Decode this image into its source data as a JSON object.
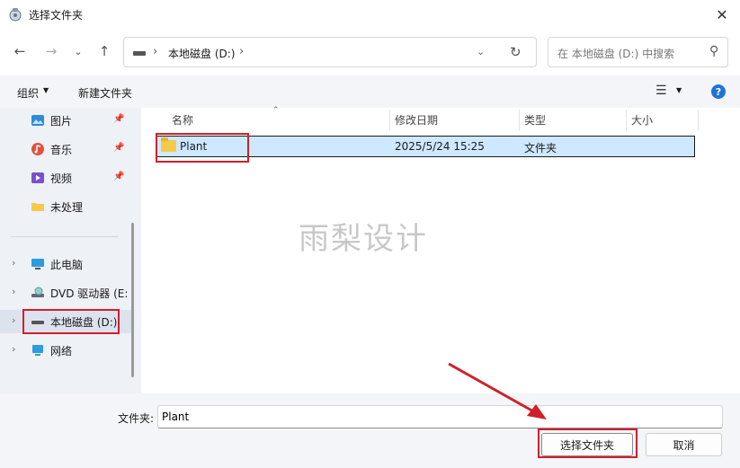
{
  "window": {
    "title": "选择文件夹",
    "close_icon": "close-icon"
  },
  "nav": {
    "back_icon": "arrow-left-icon",
    "forward_icon": "arrow-right-icon",
    "recent_icon": "chevron-down-icon",
    "up_icon": "arrow-up-icon",
    "address": {
      "crumb": "本地磁盘 (D:)",
      "separator": "›"
    },
    "search": {
      "placeholder": "在 本地磁盘 (D:) 中搜索"
    }
  },
  "toolbar": {
    "organize_label": "组织",
    "new_folder_label": "新建文件夹",
    "help_label": "?"
  },
  "sidebar": {
    "quick": [
      {
        "label": "图片",
        "icon": "pictures-icon"
      },
      {
        "label": "音乐",
        "icon": "music-icon"
      },
      {
        "label": "视频",
        "icon": "video-icon"
      },
      {
        "label": "未处理",
        "icon": "folder-icon"
      }
    ],
    "tree": [
      {
        "label": "此电脑",
        "icon": "computer-icon"
      },
      {
        "label": "DVD 驱动器 (E:",
        "icon": "dvd-drive-icon"
      },
      {
        "label": "本地磁盘 (D:)",
        "icon": "drive-icon",
        "selected": true
      },
      {
        "label": "网络",
        "icon": "network-icon"
      }
    ]
  },
  "files": {
    "columns": [
      "名称",
      "修改日期",
      "类型",
      "大小"
    ],
    "rows": [
      {
        "name": "Plant",
        "modified": "2025/5/24 15:25",
        "type": "文件夹",
        "size": ""
      }
    ]
  },
  "watermark": "雨梨设计",
  "footer": {
    "filename_label": "文件夹:",
    "filename_value": "Plant",
    "select_button": "选择文件夹",
    "cancel_button": "取消"
  },
  "colors": {
    "accent": "#1e73d8",
    "selection": "#cde8ff",
    "annotation": "#d0202a"
  }
}
